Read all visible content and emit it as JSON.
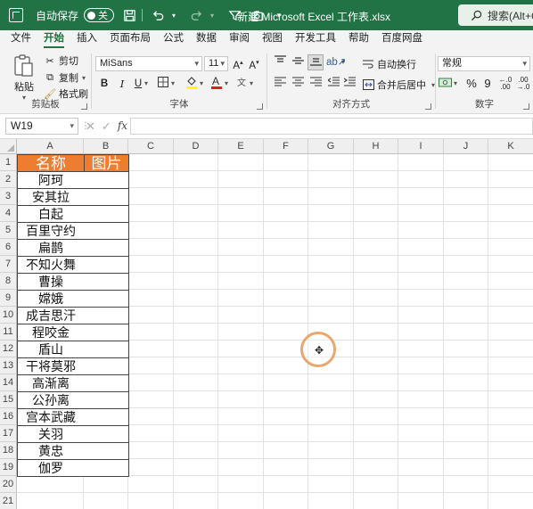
{
  "titlebar": {
    "autosave_label": "自动保存",
    "autosave_state": "关",
    "doc_title": "新建 Microsoft Excel 工作表.xlsx",
    "search_placeholder": "搜索(Alt+Q)"
  },
  "ribbon_tabs": [
    "文件",
    "开始",
    "插入",
    "页面布局",
    "公式",
    "数据",
    "审阅",
    "视图",
    "开发工具",
    "帮助",
    "百度网盘"
  ],
  "active_tab": "开始",
  "clipboard": {
    "paste": "粘贴",
    "cut": "剪切",
    "copy": "复制",
    "format_painter": "格式刷",
    "label": "剪贴板"
  },
  "font": {
    "name": "MiSans",
    "size": "11",
    "label": "字体",
    "bold": "B",
    "italic": "I",
    "underline": "U"
  },
  "alignment": {
    "wrap": "自动换行",
    "merge": "合并后居中",
    "label": "对齐方式"
  },
  "number": {
    "format": "常规",
    "label": "数字",
    "percent": "%",
    "comma": "9"
  },
  "formula_bar": {
    "name_box": "W19",
    "fx": "fx",
    "value": ""
  },
  "columns": [
    "A",
    "B",
    "C",
    "D",
    "E",
    "F",
    "G",
    "H",
    "I",
    "J",
    "K"
  ],
  "rows": [
    "1",
    "2",
    "3",
    "4",
    "5",
    "6",
    "7",
    "8",
    "9",
    "10",
    "11",
    "12",
    "13",
    "14",
    "15",
    "16",
    "17",
    "18",
    "19",
    "20",
    "21"
  ],
  "table": {
    "header_a": "名称",
    "header_b": "图片",
    "header_color": "#ed7d31",
    "names": [
      "阿珂",
      "安其拉",
      "白起",
      "百里守约",
      "扁鹊",
      "不知火舞",
      "曹操",
      "嫦娥",
      "成吉思汗",
      "程咬金",
      "盾山",
      "干将莫邪",
      "高渐离",
      "公孙离",
      "宫本武藏",
      "关羽",
      "黄忠",
      "伽罗"
    ]
  },
  "colors": {
    "excel_green": "#217346",
    "cursor_ring": "#e9a66d"
  }
}
